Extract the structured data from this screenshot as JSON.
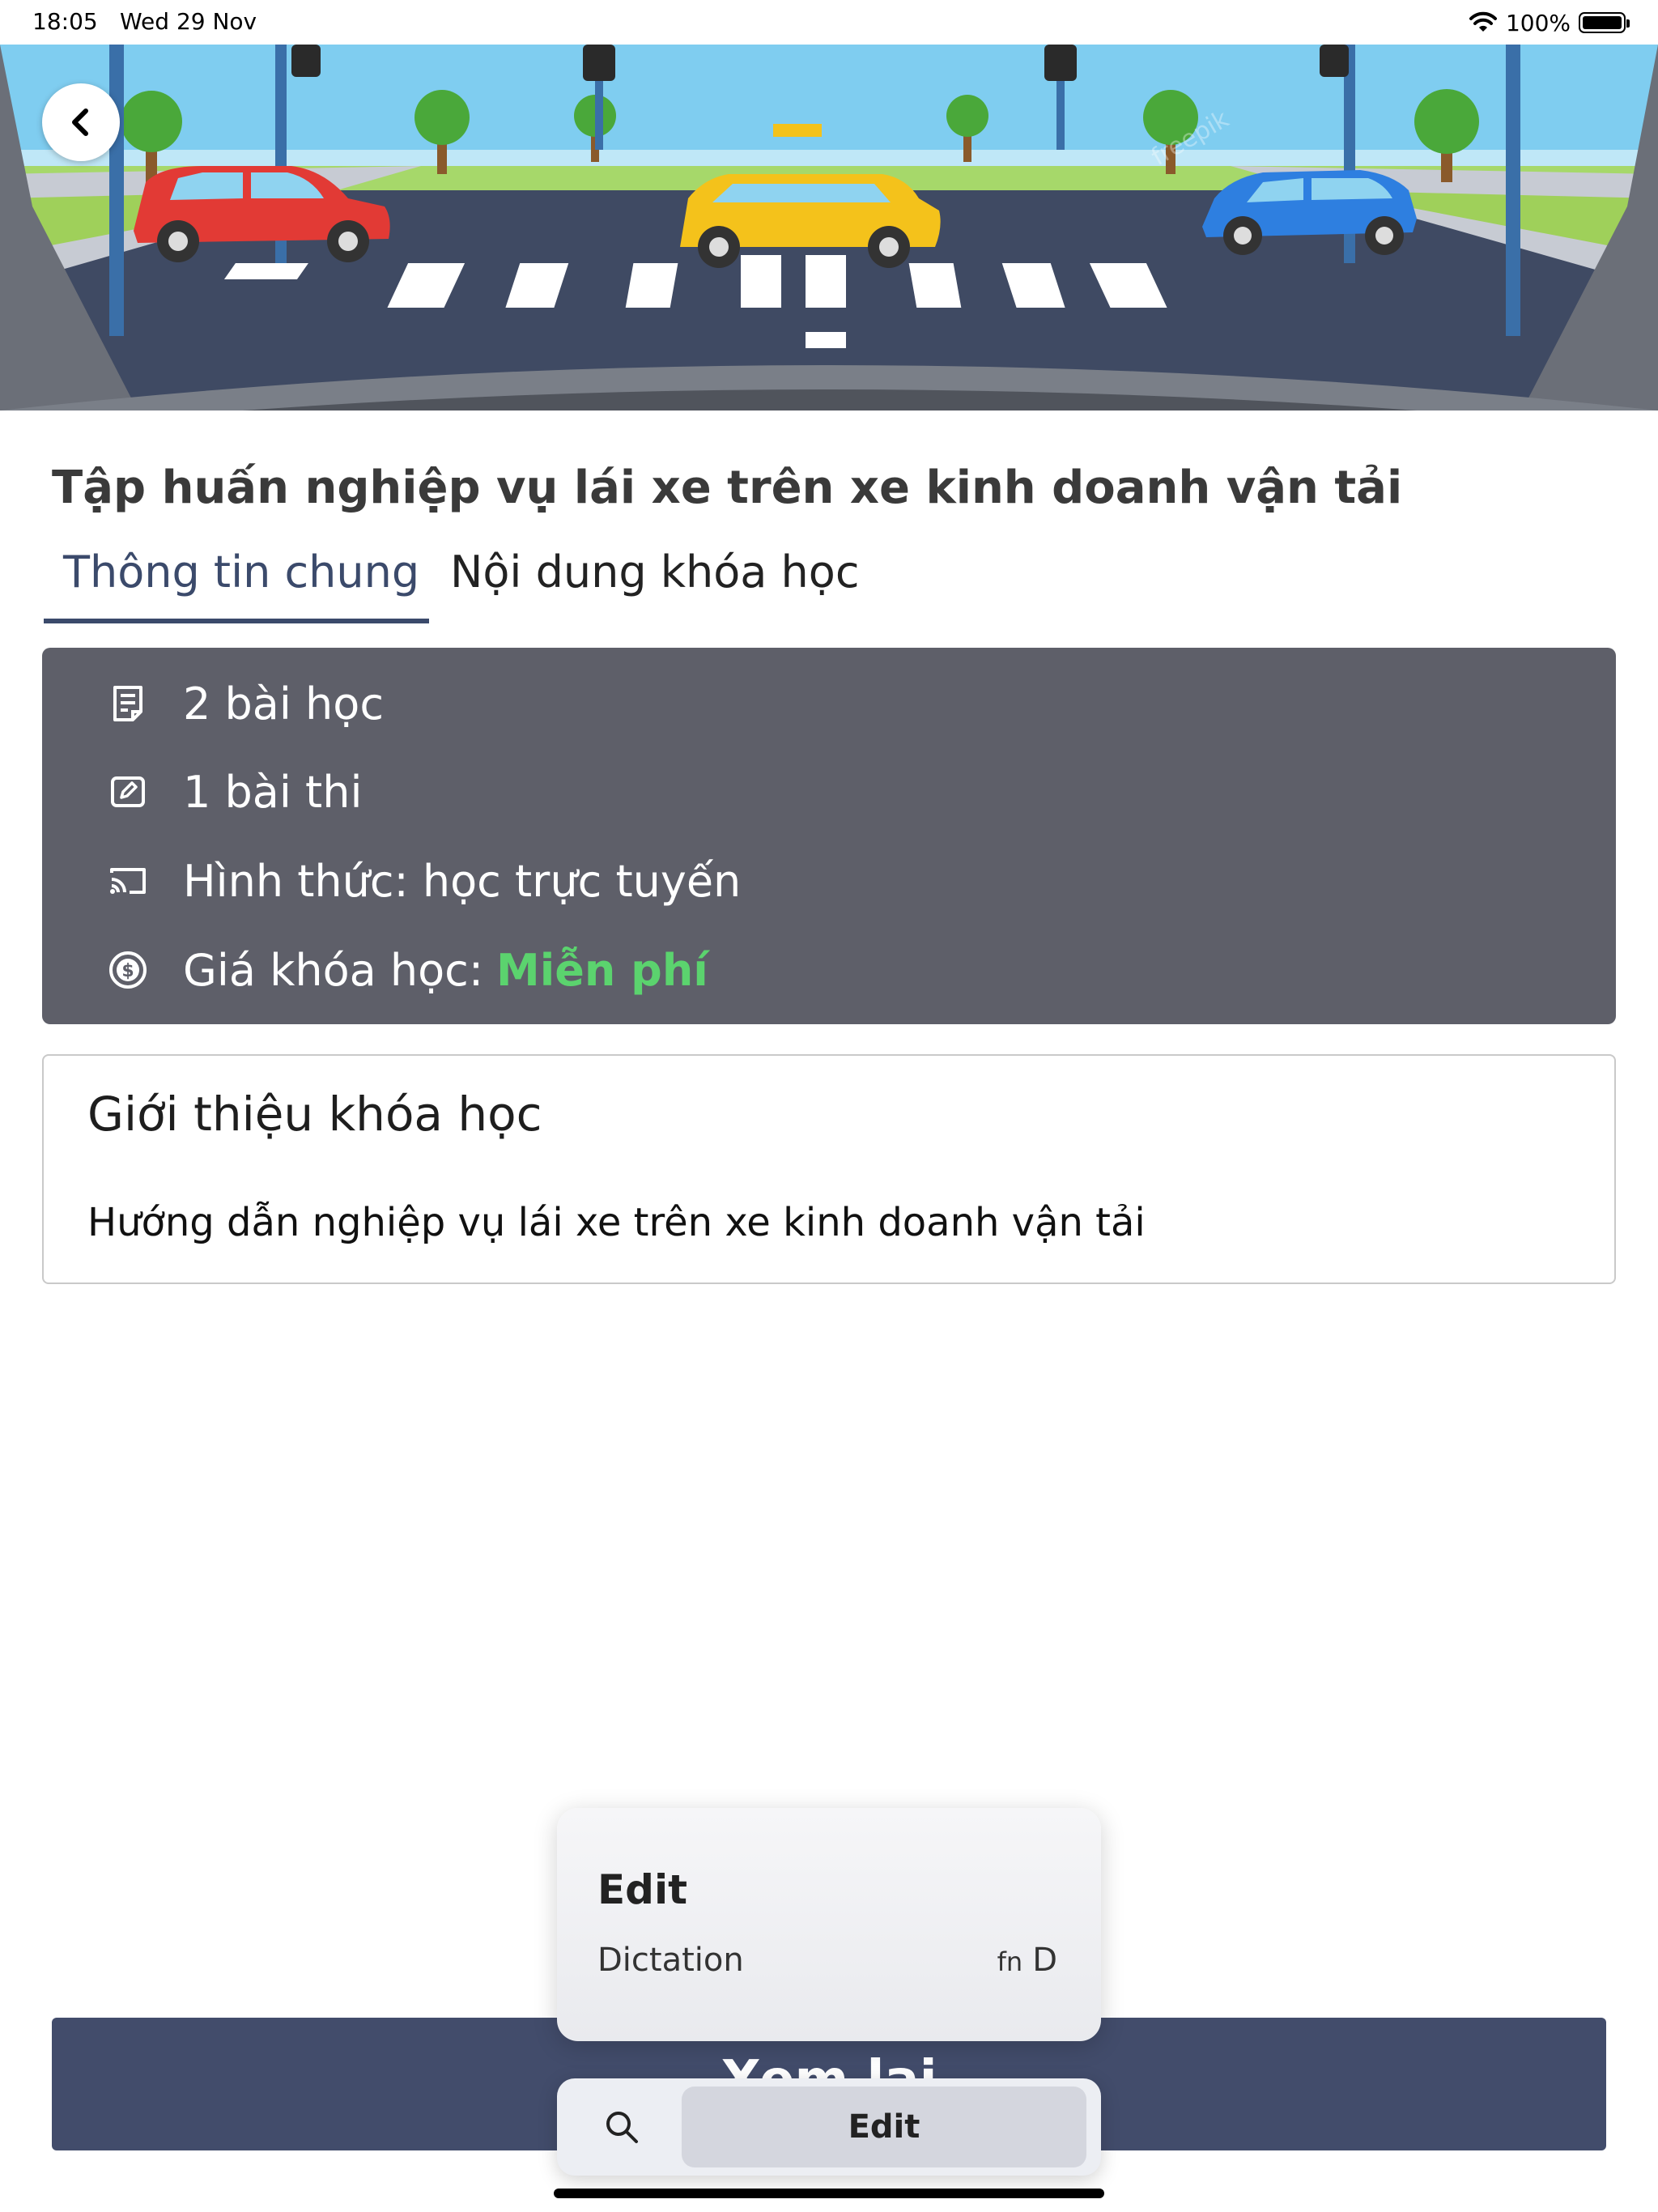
{
  "status_bar": {
    "time": "18:05",
    "date": "Wed 29 Nov",
    "battery": "100%"
  },
  "course": {
    "title": "Tập huấn nghiệp vụ lái xe trên xe kinh doanh vận tải",
    "tabs": [
      {
        "label": "Thông tin chung",
        "active": true
      },
      {
        "label": "Nội dung khóa học",
        "active": false
      }
    ],
    "info": {
      "lessons": "2 bài học",
      "exams": "1 bài thi",
      "format": "Hình thức: học trực tuyến",
      "price_label": "Giá khóa học:",
      "price_value": "Miễn phí"
    },
    "intro": {
      "title": "Giới thiệu khóa học",
      "text": "Hướng dẫn nghiệp vụ lái xe trên xe kinh doanh vận tải"
    },
    "action_button": "Xem lại"
  },
  "edit_popup": {
    "title": "Edit",
    "item": "Dictation",
    "shortcut_fn": "fn",
    "shortcut_key": "D"
  },
  "toolbar": {
    "edit_label": "Edit"
  },
  "colors": {
    "accent": "#3b4a6b",
    "info_card": "#5e5f69",
    "price": "#5bd36e",
    "button": "#424c6b"
  },
  "hero": {
    "watermark": "freepik"
  }
}
